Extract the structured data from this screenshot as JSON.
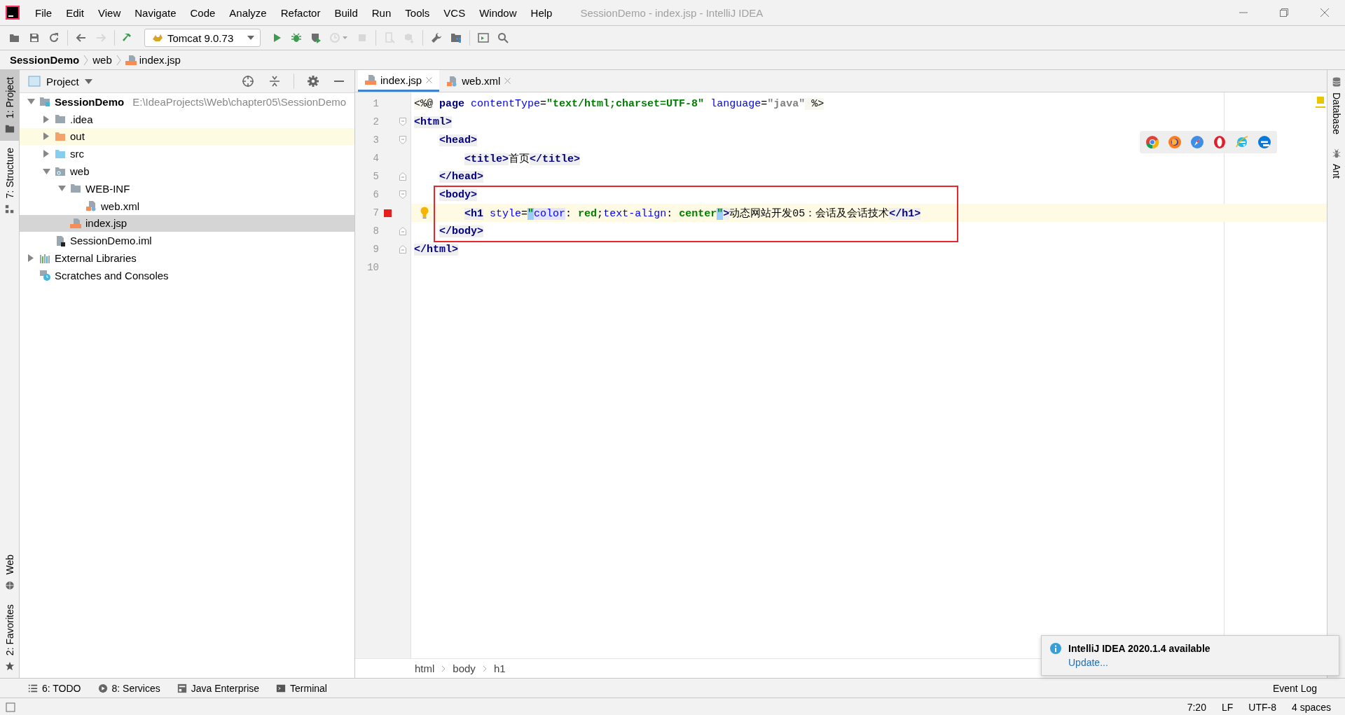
{
  "window": {
    "title": "SessionDemo - index.jsp - IntelliJ IDEA"
  },
  "menu": [
    "File",
    "Edit",
    "View",
    "Navigate",
    "Code",
    "Analyze",
    "Refactor",
    "Build",
    "Run",
    "Tools",
    "VCS",
    "Window",
    "Help"
  ],
  "toolbar": {
    "run_config": "Tomcat 9.0.73",
    "items": [
      {
        "kind": "open",
        "disabled": false
      },
      {
        "kind": "save",
        "disabled": false
      },
      {
        "kind": "sync",
        "disabled": false
      },
      {
        "kind": "separator"
      },
      {
        "kind": "back",
        "disabled": false
      },
      {
        "kind": "forward",
        "disabled": true
      },
      {
        "kind": "separator"
      },
      {
        "kind": "build",
        "disabled": false
      },
      {
        "kind": "config"
      },
      {
        "kind": "run",
        "disabled": false
      },
      {
        "kind": "debug",
        "disabled": false
      },
      {
        "kind": "coverage",
        "disabled": false
      },
      {
        "kind": "profile",
        "disabled": true
      },
      {
        "kind": "stop",
        "disabled": true
      },
      {
        "kind": "separator"
      },
      {
        "kind": "device",
        "disabled": true
      },
      {
        "kind": "box",
        "disabled": true
      },
      {
        "kind": "separator"
      },
      {
        "kind": "wrench",
        "disabled": false
      },
      {
        "kind": "structure",
        "disabled": false
      },
      {
        "kind": "separator"
      },
      {
        "kind": "terminal",
        "disabled": false
      },
      {
        "kind": "search",
        "disabled": false
      }
    ]
  },
  "breadcrumb": [
    {
      "label": "SessionDemo",
      "kind": "project"
    },
    {
      "label": "web",
      "kind": "folder"
    },
    {
      "label": "index.jsp",
      "kind": "jsp"
    }
  ],
  "left_strip": {
    "top": [
      {
        "label": "1: Project",
        "kind": "folder",
        "selected": true
      },
      {
        "label": "7: Structure",
        "kind": "structure",
        "selected": false
      }
    ],
    "bottom": [
      {
        "label": "Web",
        "kind": "globe",
        "selected": false
      },
      {
        "label": "2: Favorites",
        "kind": "star",
        "selected": false
      }
    ]
  },
  "project_panel": {
    "title": "Project",
    "tree": [
      {
        "name": "SessionDemo",
        "path": "E:\\IdeaProjects\\Web\\chapter05\\SessionDemo",
        "kind": "module",
        "expanded": true,
        "selected": false,
        "highlighted": false,
        "children": [
          {
            "name": ".idea",
            "kind": "folder",
            "expanded": false,
            "selected": false,
            "highlighted": false
          },
          {
            "name": "out",
            "kind": "folder-excluded",
            "expanded": false,
            "selected": false,
            "highlighted": true
          },
          {
            "name": "src",
            "kind": "folder-source",
            "expanded": false,
            "selected": false,
            "highlighted": false
          },
          {
            "name": "web",
            "kind": "folder-web",
            "expanded": true,
            "selected": false,
            "highlighted": false,
            "children": [
              {
                "name": "WEB-INF",
                "kind": "folder",
                "expanded": true,
                "selected": false,
                "highlighted": false,
                "children": [
                  {
                    "name": "web.xml",
                    "kind": "xml",
                    "selected": false,
                    "highlighted": false
                  }
                ]
              },
              {
                "name": "index.jsp",
                "kind": "jsp",
                "selected": true,
                "highlighted": false
              }
            ]
          },
          {
            "name": "SessionDemo.iml",
            "kind": "iml",
            "selected": false,
            "highlighted": false
          }
        ]
      },
      {
        "name": "External Libraries",
        "kind": "libraries",
        "expanded": false,
        "selected": false,
        "highlighted": false
      },
      {
        "name": "Scratches and Consoles",
        "kind": "scratches",
        "selected": false,
        "highlighted": false
      }
    ]
  },
  "editor": {
    "tabs": [
      {
        "label": "index.jsp",
        "kind": "jsp",
        "selected": true
      },
      {
        "label": "web.xml",
        "kind": "xml",
        "selected": false
      }
    ],
    "lines": [
      {
        "number": "1",
        "current": false,
        "breakpoint": false,
        "intention": false,
        "fold_start": false,
        "fold_end": false,
        "tokens": [
          {
            "text": "<%@",
            "kind": "directive"
          },
          {
            "text": " page",
            "kind": "keyword"
          },
          {
            "text": " contentType",
            "kind": "attr"
          },
          {
            "text": "=",
            "kind": "plain"
          },
          {
            "text": "\"text/html;charset=UTF-8\"",
            "kind": "value"
          },
          {
            "text": " language",
            "kind": "attr"
          },
          {
            "text": "=",
            "kind": "plain"
          },
          {
            "text": "\"java\"",
            "kind": "muted"
          },
          {
            "text": " %>",
            "kind": "directive"
          }
        ]
      },
      {
        "number": "2",
        "current": false,
        "breakpoint": false,
        "intention": false,
        "fold_start": true,
        "fold_end": false,
        "tokens": [
          {
            "text": "<html>",
            "kind": "tag"
          }
        ],
        "children": [
          {
            "number": "3",
            "current": false,
            "breakpoint": false,
            "intention": false,
            "fold_start": true,
            "fold_end": false,
            "tokens": [
              {
                "text": "<head>",
                "kind": "tag"
              }
            ],
            "children": [
              {
                "number": "4",
                "current": false,
                "breakpoint": false,
                "intention": false,
                "fold_start": false,
                "fold_end": false,
                "tokens": [
                  {
                    "text": "<title>",
                    "kind": "tag"
                  },
                  {
                    "text": "首页",
                    "kind": "plain"
                  },
                  {
                    "text": "</title>",
                    "kind": "tag"
                  }
                ]
              }
            ]
          },
          {
            "number": "5",
            "current": false,
            "breakpoint": false,
            "intention": false,
            "fold_start": false,
            "fold_end": true,
            "tokens": [
              {
                "text": "</head>",
                "kind": "tag"
              }
            ]
          },
          {
            "number": "6",
            "current": false,
            "breakpoint": false,
            "intention": false,
            "fold_start": true,
            "fold_end": false,
            "tokens": [
              {
                "text": "<body>",
                "kind": "tag"
              }
            ],
            "children": [
              {
                "number": "7",
                "current": true,
                "breakpoint": true,
                "intention": true,
                "fold_start": false,
                "fold_end": false,
                "tokens": [
                  {
                    "text": "<h1",
                    "kind": "tag"
                  },
                  {
                    "text": " style",
                    "kind": "attr"
                  },
                  {
                    "text": "=",
                    "kind": "plain"
                  },
                  {
                    "text": "\"",
                    "kind": "match"
                  },
                  {
                    "text": "color",
                    "kind": "attr-hl"
                  },
                  {
                    "text": ": ",
                    "kind": "plain"
                  },
                  {
                    "text": "red",
                    "kind": "value"
                  },
                  {
                    "text": ";",
                    "kind": "plain"
                  },
                  {
                    "text": "text-align",
                    "kind": "attr"
                  },
                  {
                    "text": ": ",
                    "kind": "plain"
                  },
                  {
                    "text": "center",
                    "kind": "value"
                  },
                  {
                    "text": "\"",
                    "kind": "match"
                  },
                  {
                    "text": ">",
                    "kind": "tag"
                  },
                  {
                    "text": "动态网站开发05：会话及会话技术",
                    "kind": "plain"
                  },
                  {
                    "text": "</h1>",
                    "kind": "tag"
                  }
                ]
              }
            ]
          },
          {
            "number": "8",
            "current": false,
            "breakpoint": false,
            "intention": false,
            "fold_start": false,
            "fold_end": true,
            "tokens": [
              {
                "text": "</body>",
                "kind": "tag"
              }
            ]
          }
        ]
      },
      {
        "number": "9",
        "current": false,
        "breakpoint": false,
        "intention": false,
        "fold_start": false,
        "fold_end": true,
        "tokens": [
          {
            "text": "</html>",
            "kind": "tag"
          }
        ]
      },
      {
        "number": "10",
        "current": false,
        "breakpoint": false,
        "intention": false,
        "fold_start": false,
        "fold_end": false
      }
    ],
    "browsers": [
      {
        "kind": "chrome"
      },
      {
        "kind": "firefox"
      },
      {
        "kind": "safari"
      },
      {
        "kind": "opera"
      },
      {
        "kind": "ie"
      },
      {
        "kind": "edge"
      }
    ],
    "breadcrumb": [
      "html",
      "body",
      "h1"
    ]
  },
  "right_strip": [
    {
      "label": "Database",
      "kind": "database"
    },
    {
      "label": "Ant",
      "kind": "ant"
    }
  ],
  "bottom_tools": [
    {
      "label": "6: TODO",
      "kind": "todo"
    },
    {
      "label": "8: Services",
      "kind": "services"
    },
    {
      "label": "Java Enterprise",
      "kind": "enterprise"
    },
    {
      "label": "Terminal",
      "kind": "terminal"
    }
  ],
  "event_log": "Event Log",
  "status_bar": [
    "7:20",
    "LF",
    "UTF-8",
    "4 spaces"
  ],
  "notification": {
    "title": "IntelliJ IDEA 2020.1.4 available",
    "link": "Update..."
  }
}
